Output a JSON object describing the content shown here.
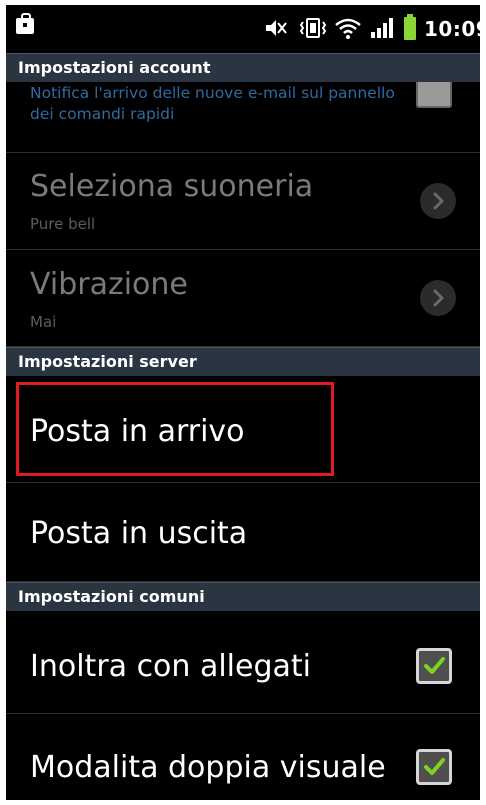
{
  "status_bar": {
    "icons": [
      "shopping-bag-icon",
      "mute-icon",
      "vibrate-icon",
      "wifi-icon",
      "signal-icon",
      "battery-icon"
    ],
    "time": "10:09"
  },
  "sections": {
    "account": "Impostazioni account",
    "server": "Impostazioni server",
    "common": "Impostazioni comuni"
  },
  "account": {
    "notify_text": "Notifica l'arrivo delle nuove e-mail sul pannello dei comandi rapidi",
    "ringtone_title": "Seleziona suoneria",
    "ringtone_value": "Pure bell",
    "vibration_title": "Vibrazione",
    "vibration_value": "Mai"
  },
  "server": {
    "incoming_label": "Posta in arrivo",
    "outgoing_label": "Posta in uscita"
  },
  "common": {
    "forward_label": "Inoltra con allegati",
    "forward_checked": true,
    "dual_view_label": "Modalita doppia visuale",
    "dual_view_checked": true
  },
  "colors": {
    "section_header_bg": "#2a3541",
    "highlight": "#e11b22",
    "check": "#7ed321",
    "notify_text": "#2e6ba0"
  }
}
